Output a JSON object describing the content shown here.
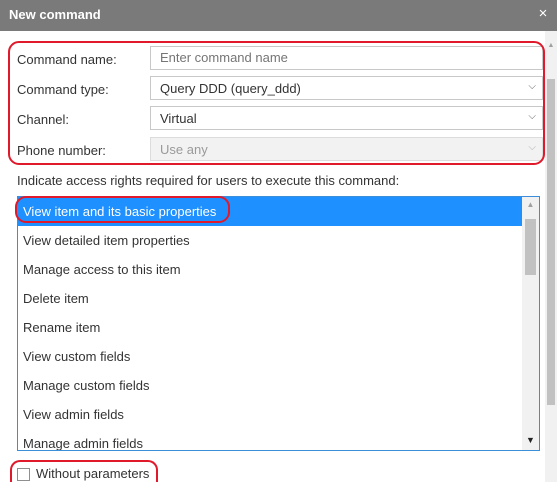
{
  "dialog": {
    "title": "New command",
    "close_glyph": "×"
  },
  "form": {
    "command_name_label": "Command name:",
    "command_name_placeholder": "Enter command name",
    "command_type_label": "Command type:",
    "command_type_value": "Query DDD (query_ddd)",
    "channel_label": "Channel:",
    "channel_value": "Virtual",
    "phone_number_label": "Phone number:",
    "phone_number_value": "Use any",
    "chevron_glyph": "⌵"
  },
  "access": {
    "hint": "Indicate access rights required for users to execute this command:",
    "items": [
      "View item and its basic properties",
      "View detailed item properties",
      "Manage access to this item",
      "Delete item",
      "Rename item",
      "View custom fields",
      "Manage custom fields",
      "View admin fields",
      "Manage admin fields"
    ],
    "selected_index": 0
  },
  "options": {
    "without_parameters_label": "Without parameters",
    "without_parameters_checked": false
  },
  "colors": {
    "titlebar": "#7a7a7a",
    "selection": "#1e90ff",
    "highlight_frame": "#e0192b"
  }
}
